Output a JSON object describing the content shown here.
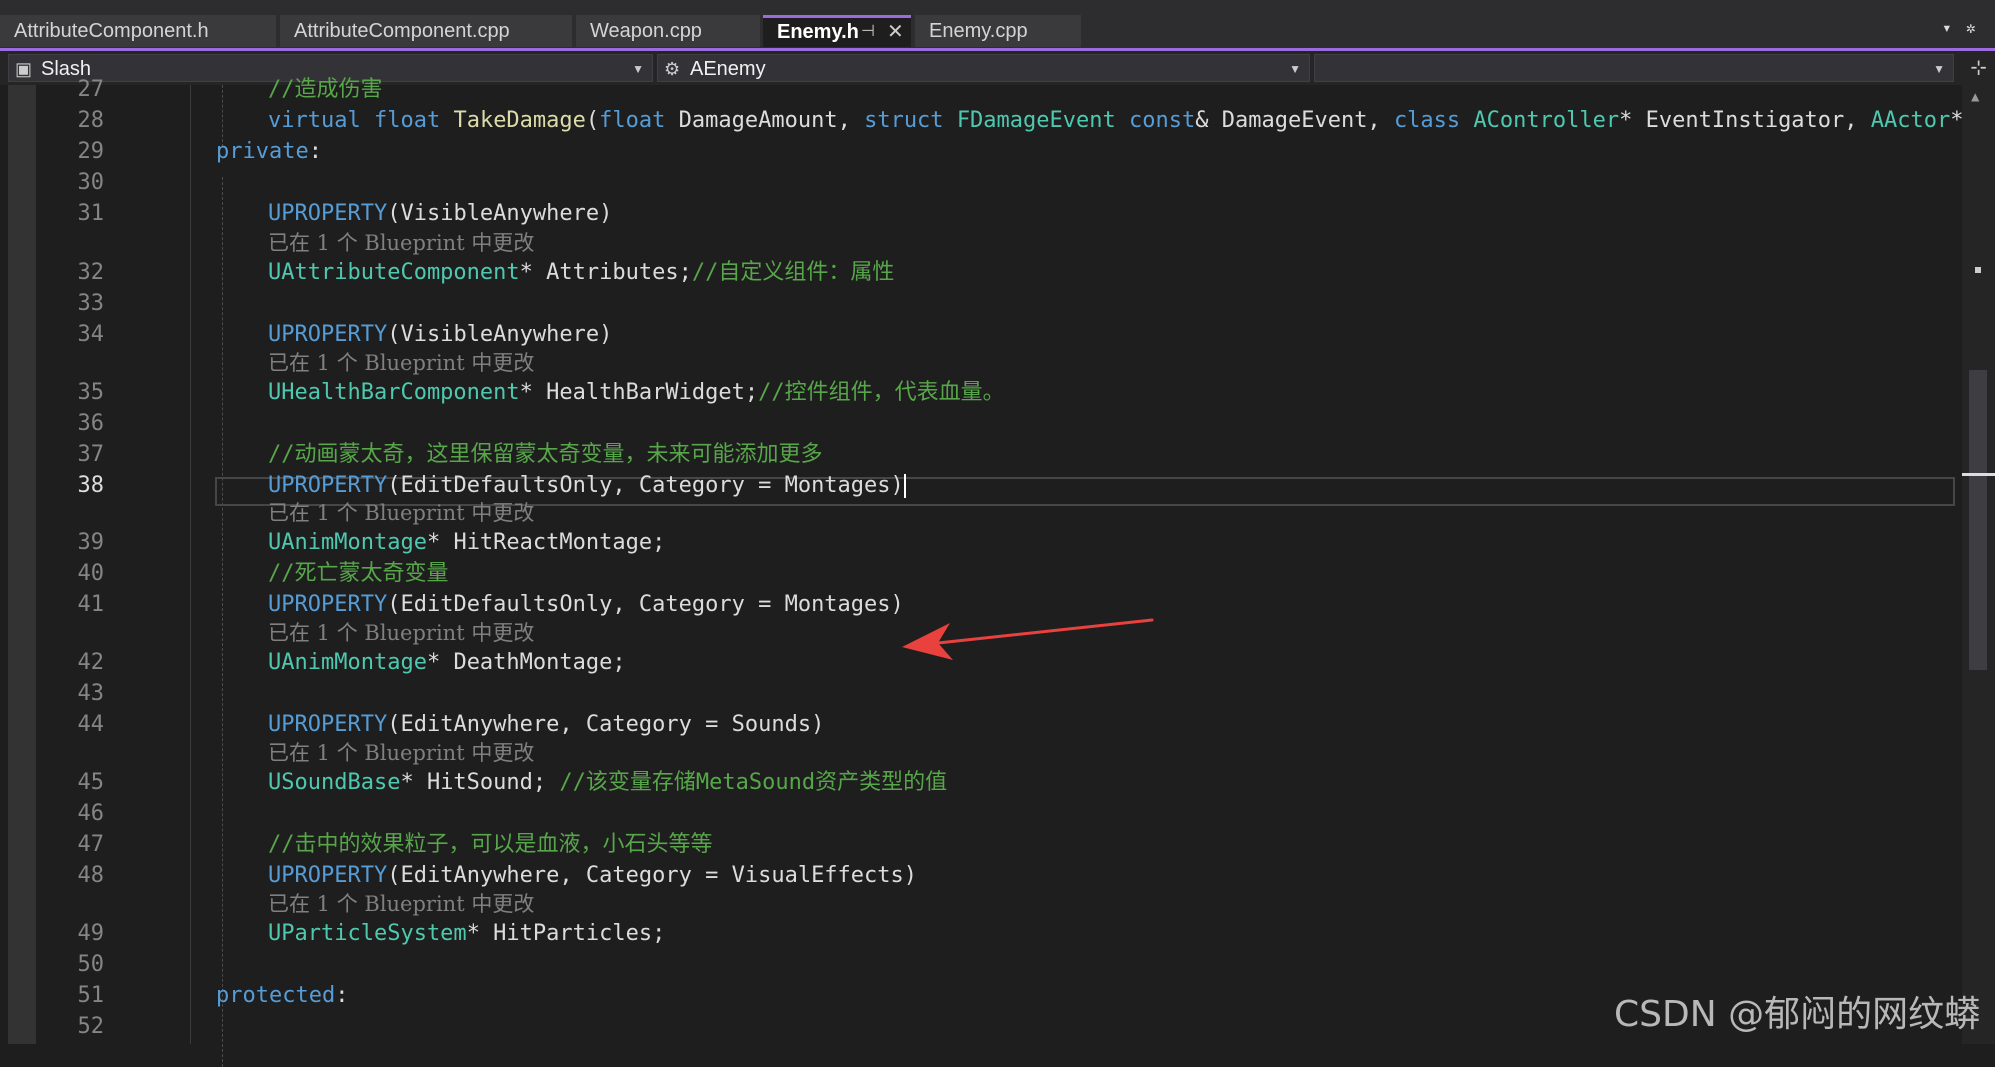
{
  "tabs": [
    {
      "label": "AttributeComponent.h"
    },
    {
      "label": "AttributeComponent.cpp"
    },
    {
      "label": "Weapon.cpp"
    },
    {
      "label": "Enemy.h",
      "pin": "⊣",
      "close": "✕"
    },
    {
      "label": "Enemy.cpp"
    }
  ],
  "navbar": {
    "project": "Slash",
    "scope": "AEnemy",
    "member": ""
  },
  "lines": {
    "l27": "27",
    "l28": "28",
    "l29": "29",
    "l30": "30",
    "l31": "31",
    "l32": "32",
    "l33": "33",
    "l34": "34",
    "l35": "35",
    "l36": "36",
    "l37": "37",
    "l38": "38",
    "l39": "39",
    "l40": "40",
    "l41": "41",
    "l42": "42",
    "l43": "43",
    "l44": "44",
    "l45": "45",
    "l46": "46",
    "l47": "47",
    "l48": "48",
    "l49": "49",
    "l50": "50",
    "l51": "51",
    "l52": "52"
  },
  "code": {
    "c27_comment": "//造成伤害",
    "c28_virtual": "virtual",
    "c28_float": "float",
    "c28_fn": "TakeDamage",
    "c28_paren": "(",
    "c28_float2": "float",
    "c28_p1": " DamageAmount, ",
    "c28_struct": "struct",
    "c28_t1": "FDamageEvent",
    "c28_const": "const",
    "c28_p2": "& DamageEvent, ",
    "c28_class": "class",
    "c28_t2": "AController",
    "c28_p3": "* EventInstigator, ",
    "c28_t3": "AActor",
    "c28_p4": "* D",
    "c29_private": "private",
    "c29_colon": ":",
    "uprop": "UPROPERTY",
    "c31_args": "(VisibleAnywhere)",
    "c32_type": "UAttributeComponent",
    "c32_rest": "* Attributes;",
    "c32_comment": "//自定义组件：属性",
    "c34_args": "(VisibleAnywhere)",
    "c35_type": "UHealthBarComponent",
    "c35_rest": "* HealthBarWidget;",
    "c35_comment": "//控件组件，代表血量。",
    "c37_comment": "//动画蒙太奇，这里保留蒙太奇变量，未来可能添加更多",
    "c38_args": "(EditDefaultsOnly, Category = Montages)",
    "c39_type": "UAnimMontage",
    "c39_rest": "* HitReactMontage;",
    "c40_comment": "//死亡蒙太奇变量",
    "c41_args": "(EditDefaultsOnly, Category = Montages)",
    "c42_type": "UAnimMontage",
    "c42_rest": "* DeathMontage;",
    "c44_args": "(EditAnywhere, Category = Sounds)",
    "c45_type": "USoundBase",
    "c45_rest": "* HitSound; ",
    "c45_comment": "//该变量存储MetaSound资产类型的值",
    "c47_comment": "//击中的效果粒子，可以是血液，小石头等等",
    "c48_args": "(EditAnywhere, Category = VisualEffects)",
    "c49_type": "UParticleSystem",
    "c49_rest": "* HitParticles;",
    "c51_protected": "protected",
    "c51_colon": ":"
  },
  "hint_text": "已在 1 个 Blueprint 中更改",
  "watermark": "CSDN @郁闷的网纹蟒",
  "colors": {
    "keyword": "#569cd6",
    "type": "#4ec9b0",
    "function": "#dcdcaa",
    "comment": "#57a64a",
    "annotation_arrow": "#e8413e",
    "tab_accent": "#9b6bdf"
  }
}
